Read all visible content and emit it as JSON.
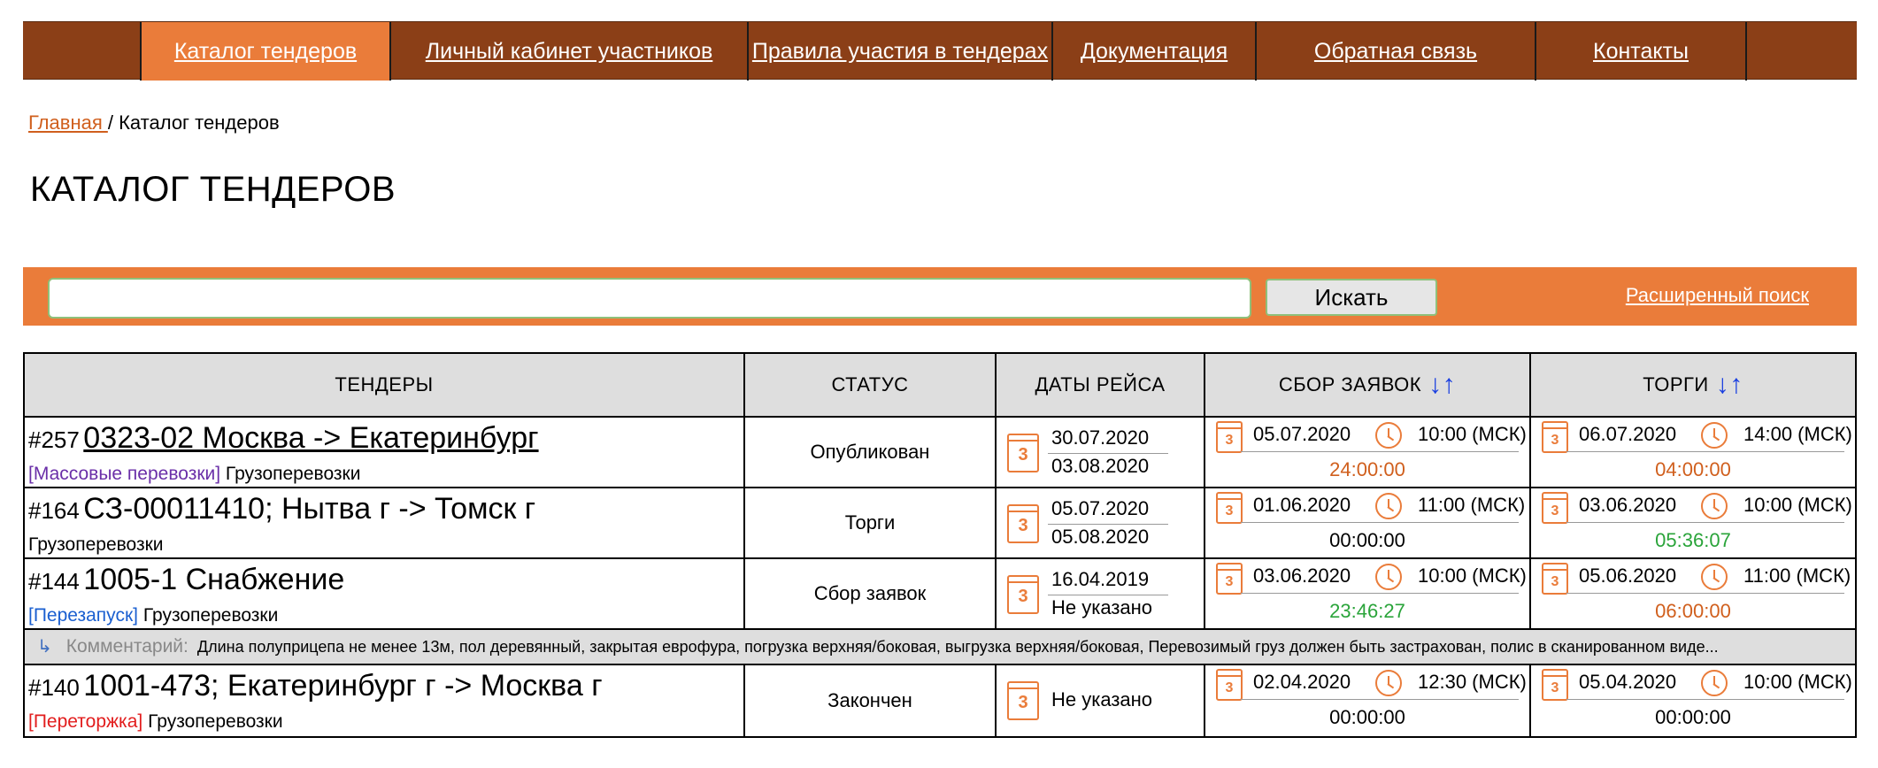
{
  "nav": {
    "items": [
      {
        "label": "Каталог тендеров"
      },
      {
        "label": "Личный кабинет участников"
      },
      {
        "label": "Правила участия в тендерах"
      },
      {
        "label": "Документация"
      },
      {
        "label": "Обратная связь"
      },
      {
        "label": "Контакты"
      }
    ],
    "active_index": 0
  },
  "breadcrumb": {
    "home": "Главная ",
    "sep": "/",
    "current": " Каталог тендеров"
  },
  "page_title": "КАТАЛОГ ТЕНДЕРОВ",
  "search": {
    "value": "",
    "button": "Искать",
    "advanced": "Расширенный поиск"
  },
  "table": {
    "headers": {
      "tenders": "ТЕНДЕРЫ",
      "status": "СТАТУС",
      "dates": "ДАТЫ РЕЙСА",
      "collect": "СБОР ЗАЯВОК",
      "trade": "ТОРГИ",
      "sort_icon": "↓↑"
    },
    "calendar_glyph": "3",
    "rows": [
      {
        "num": "#257",
        "name": "0323-02 Москва -> Екатеринбург",
        "tag": "[Массовые перевозки]",
        "category": "Грузоперевозки",
        "status": "Опубликован",
        "trip_from": "30.07.2020",
        "trip_to": "03.08.2020",
        "collect_date": "05.07.2020",
        "collect_time": "10:00 (МСК)",
        "collect_timer": "24:00:00",
        "trade_date": "06.07.2020",
        "trade_time": "14:00 (МСК)",
        "trade_timer": "04:00:00"
      },
      {
        "num": "#164",
        "name": "СЗ-00011410; Нытва г -> Томск г",
        "tag": "",
        "category": "Грузоперевозки",
        "status": "Торги",
        "trip_from": "05.07.2020",
        "trip_to": "05.08.2020",
        "collect_date": "01.06.2020",
        "collect_time": "11:00 (МСК)",
        "collect_timer": "00:00:00",
        "trade_date": "03.06.2020",
        "trade_time": "10:00 (МСК)",
        "trade_timer": "05:36:07"
      },
      {
        "num": "#144",
        "name": "1005-1 Снабжение",
        "tag": "[Перезапуск]",
        "category": "Грузоперевозки",
        "status": "Сбор заявок",
        "trip_from": "16.04.2019",
        "trip_to": "Не указано",
        "collect_date": "03.06.2020",
        "collect_time": "10:00 (МСК)",
        "collect_timer": "23:46:27",
        "trade_date": "05.06.2020",
        "trade_time": "11:00 (МСК)",
        "trade_timer": "06:00:00"
      },
      {
        "num": "#140",
        "name": "1001-473; Екатеринбург г -> Москва г",
        "tag": "[Переторжка]",
        "category": "Грузоперевозки",
        "status": "Закончен",
        "trip_single": "Не указано",
        "collect_date": "02.04.2020",
        "collect_time": "12:30 (МСК)",
        "collect_timer": "00:00:00",
        "trade_date": "05.04.2020",
        "trade_time": "10:00 (МСК)",
        "trade_timer": "00:00:00"
      }
    ],
    "comment": {
      "arrow": "↳",
      "label": "Комментарий:",
      "text": "Длина полуприцепа не менее 13м, пол деревянный, закрытая еврофура, погрузка верхняя/боковая, выгрузка верхняя/боковая, Перевозимый груз должен быть застрахован, полис в сканированном виде..."
    }
  },
  "colors": {
    "nav_bg": "#8b3f17",
    "accent": "#ea7c3a",
    "timer_orange": "#d05f1d",
    "timer_green": "#2aa43a",
    "tag_mass": "#6a2fa8",
    "tag_restart": "#1a5fd0",
    "tag_retrade": "#e21d1d"
  }
}
